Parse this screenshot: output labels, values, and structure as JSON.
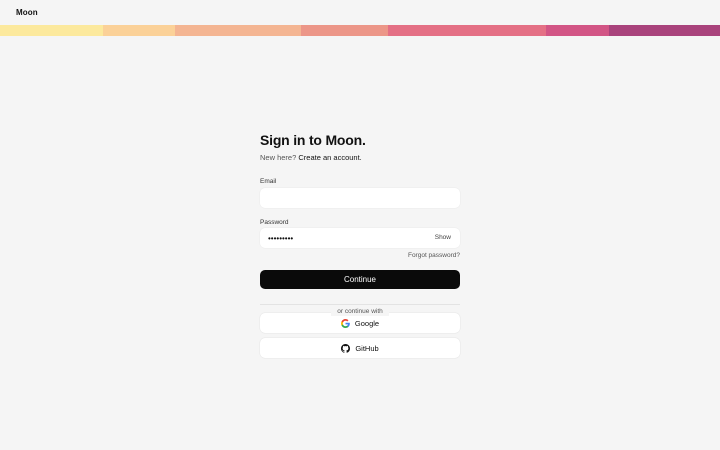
{
  "app": {
    "brand": "Moon"
  },
  "colors": {
    "background": "#f5f5f5",
    "primary_button": "#0a0a0a",
    "stripe": [
      "#fce99d",
      "#fbd198",
      "#f4b592",
      "#ec9688",
      "#e47085",
      "#d25585",
      "#a9437c"
    ]
  },
  "auth": {
    "title": "Sign in to Moon.",
    "subline_prefix": "New here?",
    "subline_link": "Create an account.",
    "email_label": "Email",
    "email_value": "",
    "password_label": "Password",
    "password_value": "•••••••••",
    "show_label": "Show",
    "forgot_label": "Forgot password?",
    "continue_label": "Continue",
    "divider_text": "or continue with",
    "providers": [
      {
        "label": "Google",
        "icon": "google-icon"
      },
      {
        "label": "GitHub",
        "icon": "github-icon"
      }
    ]
  }
}
